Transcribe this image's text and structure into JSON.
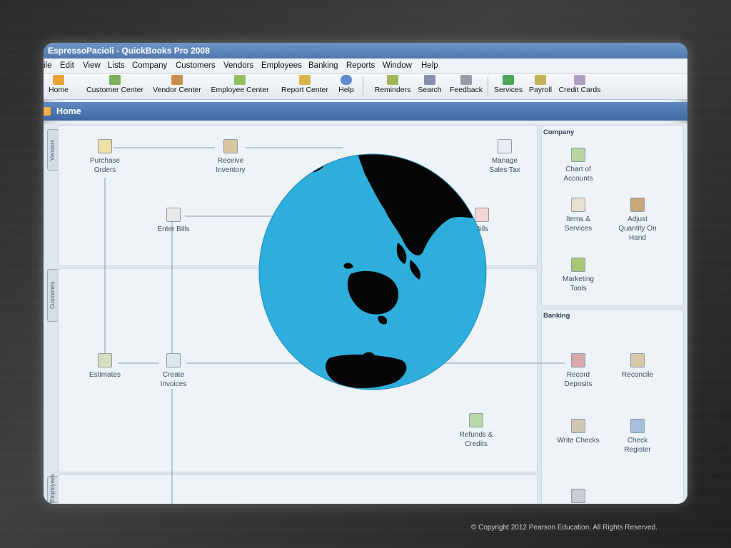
{
  "window": {
    "title": "EspressoPacioli  - QuickBooks Pro 2008"
  },
  "menu": [
    "ile",
    "Edit",
    "View",
    "Lists",
    "Company",
    "Customers",
    "Vendors",
    "Employees",
    "Banking",
    "Reports",
    "Window",
    "Help"
  ],
  "toolbar": {
    "home": "Home",
    "customer_center": "Customer Center",
    "vendor_center": "Vendor Center",
    "employee_center": "Employee Center",
    "report_center": "Report Center",
    "help": "Help",
    "reminders": "Reminders",
    "search": "Search",
    "feedback": "Feedback",
    "services": "Services",
    "payroll": "Payroll",
    "credit_cards": "Credit Cards"
  },
  "home_title": "Home",
  "side_tabs": {
    "vendors": "Vendors",
    "customers": "Customers",
    "employees": "Employees"
  },
  "vendors": {
    "purchase_orders": "Purchase Orders",
    "receive_inventory": "Receive Inventory",
    "manage_sales_tax": "Manage Sales Tax",
    "enter_bills": "Enter Bills",
    "pay_bills": "Bills"
  },
  "customers": {
    "estimates": "Estimates",
    "create_invoices": "Create Invoices",
    "refunds_credits": "Refunds & Credits"
  },
  "company": {
    "title": "Company",
    "chart_of_accounts": "Chart of Accounts",
    "items_services": "Items & Services",
    "adjust_quantity": "Adjust Quantity On Hand",
    "marketing_tools": "Marketing Tools"
  },
  "banking": {
    "title": "Banking",
    "record_deposits": "Record Deposits",
    "reconcile": "Reconcile",
    "write_checks": "Write Checks",
    "check_register": "Check Register"
  },
  "footer": {
    "copyright": "© Copyright 2012 Pearson Education. All Rights Reserved."
  },
  "colors": {
    "ocean": "#2eaedc",
    "land": "#050505",
    "titlebar": "#4f78ad"
  }
}
